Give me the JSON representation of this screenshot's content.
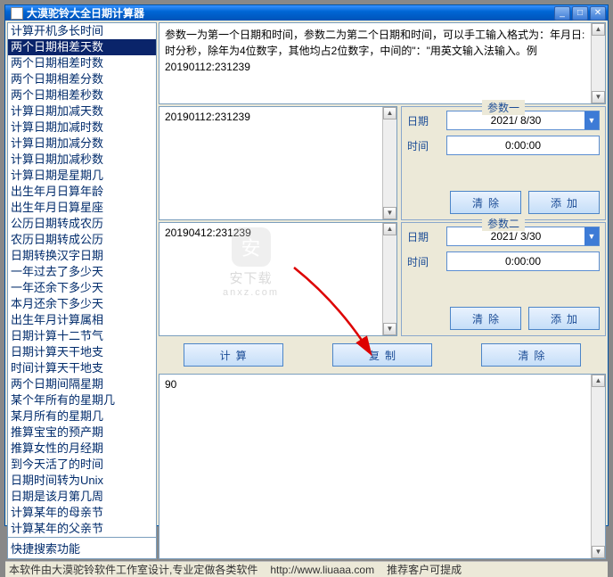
{
  "title": "大漠驼铃大全日期计算器",
  "sidebar": {
    "items": [
      "计算开机多长时间",
      "两个日期相差天数",
      "两个日期相差时数",
      "两个日期相差分数",
      "两个日期相差秒数",
      "计算日期加减天数",
      "计算日期加减时数",
      "计算日期加减分数",
      "计算日期加减秒数",
      "计算日期是星期几",
      "出生年月日算年龄",
      "出生年月日算星座",
      "公历日期转成农历",
      "农历日期转成公历",
      "日期转换汉字日期",
      "一年过去了多少天",
      "一年还余下多少天",
      "本月还余下多少天",
      "出生年月计算属相",
      "日期计算十二节气",
      "日期计算天干地支",
      "时间计算天干地支",
      "两个日期间隔星期",
      "某个年所有的星期几",
      "某月所有的星期几",
      "推算宝宝的预产期",
      "推算女性的月经期",
      "到今天活了的时间",
      "日期时间转为Unix",
      "日期是该月第几周",
      "计算某年的母亲节",
      "计算某年的父亲节"
    ],
    "selected_index": 1,
    "quick_search": "快捷搜索功能"
  },
  "instruction": "参数一为第一个日期和时间，参数二为第二个日期和时间，可以手工输入格式为：年月日:时分秒，除年为4位数字，其他均占2位数字，中间的\"：\"用英文输入法输入。例20190112:231239",
  "param1": {
    "text": "20190112:231239",
    "title": "参数一",
    "date_label": "日期",
    "date_value": "2021/ 8/30",
    "time_label": "时间",
    "time_value": "0:00:00",
    "clear": "清除",
    "add": "添加"
  },
  "param2": {
    "text": "20190412:231239",
    "title": "参数二",
    "date_label": "日期",
    "date_value": "2021/ 3/30",
    "time_label": "时间",
    "time_value": "0:00:00",
    "clear": "清除",
    "add": "添加"
  },
  "actions": {
    "calc": "计算",
    "copy": "复制",
    "clear": "清除"
  },
  "result": "90",
  "status": {
    "left": "本软件由大漠驼铃软件工作室设计,专业定做各类软件",
    "url": "http://www.liuaaa.com",
    "right": "推荐客户可提成"
  },
  "watermark": {
    "name": "安下载",
    "sub": "anxz.com"
  }
}
